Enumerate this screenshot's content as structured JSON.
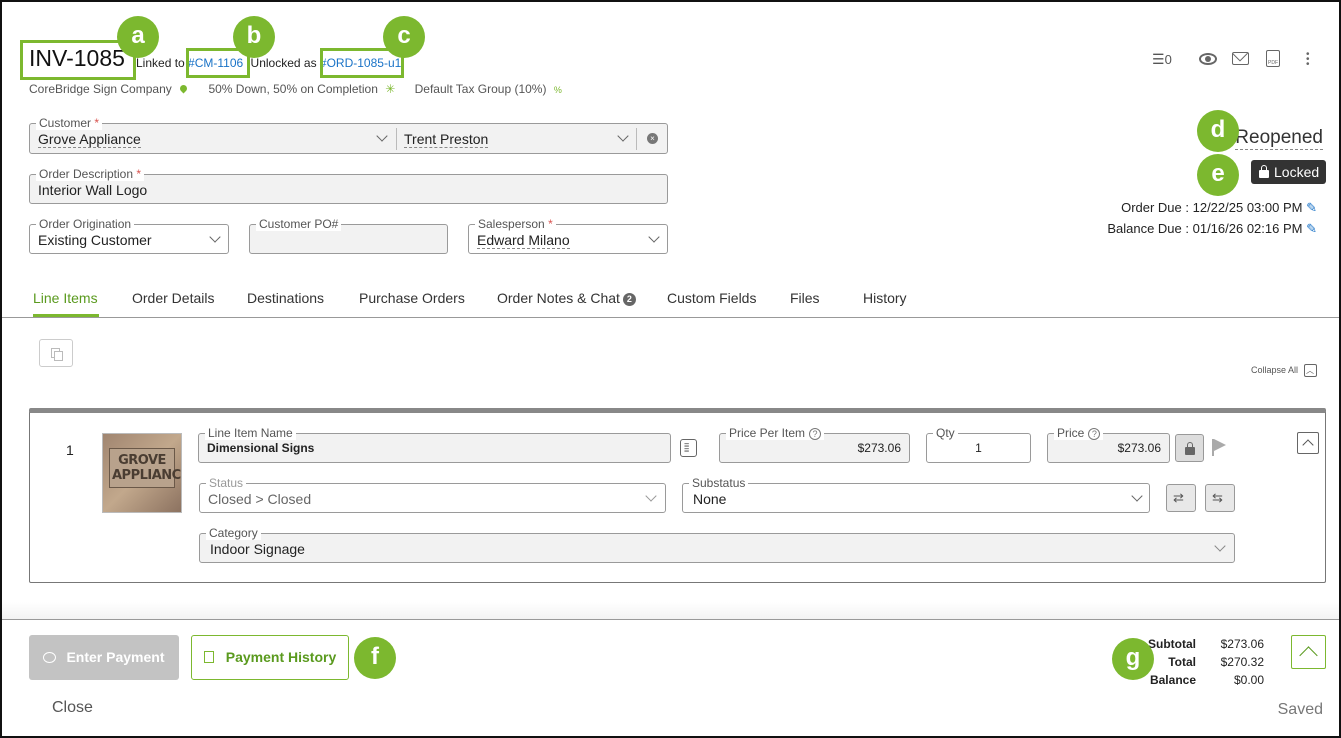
{
  "header": {
    "invoice_number": "INV-1085",
    "linked_to_label": "Linked to",
    "linked_to_value": "#CM-1106",
    "unlocked_label": "Unlocked as",
    "unlocked_value": "#ORD-1085-u1",
    "company": "CoreBridge Sign Company",
    "payment_terms": "50% Down, 50% on Completion",
    "tax_group": "Default Tax Group (10%)",
    "tasks_count": "0"
  },
  "form": {
    "customer": {
      "label": "Customer",
      "value": "Grove Appliance",
      "contact": "Trent Preston"
    },
    "description": {
      "label": "Order Description",
      "value": "Interior Wall Logo"
    },
    "origination": {
      "label": "Order Origination",
      "value": "Existing Customer"
    },
    "po": {
      "label": "Customer PO#",
      "value": ""
    },
    "salesperson": {
      "label": "Salesperson",
      "value": "Edward Milano"
    }
  },
  "status": {
    "state": "Reopened",
    "locked_label": "Locked",
    "order_due": "Order Due : 12/22/25 03:00 PM",
    "balance_due": "Balance Due : 01/16/26 02:16 PM"
  },
  "tabs": [
    {
      "label": "Line Items",
      "active": true
    },
    {
      "label": "Order Details"
    },
    {
      "label": "Destinations"
    },
    {
      "label": "Purchase Orders"
    },
    {
      "label": "Order Notes & Chat",
      "badge": "2"
    },
    {
      "label": "Custom Fields"
    },
    {
      "label": "Files"
    },
    {
      "label": "History"
    }
  ],
  "line_items": {
    "collapse_all": "Collapse All",
    "item": {
      "number": "1",
      "image_text": "GROVE APPLIANCE",
      "name_label": "Line Item Name",
      "name": "Dimensional Signs",
      "ppi_label": "Price Per Item",
      "ppi": "$273.06",
      "qty_label": "Qty",
      "qty": "1",
      "price_label": "Price",
      "price": "$273.06",
      "status_label": "Status",
      "status": "Closed > Closed",
      "substatus_label": "Substatus",
      "substatus": "None",
      "category_label": "Category",
      "category": "Indoor Signage"
    }
  },
  "footer": {
    "enter_payment": "Enter Payment",
    "payment_history": "Payment History",
    "close": "Close",
    "saved": "Saved",
    "subtotal_label": "Subtotal",
    "subtotal": "$273.06",
    "total_label": "Total",
    "total": "$270.32",
    "balance_label": "Balance",
    "balance": "$0.00"
  },
  "callouts": [
    "a",
    "b",
    "c",
    "d",
    "e",
    "f",
    "g"
  ],
  "colors": {
    "accent": "#7cb82f",
    "link": "#1a73c7",
    "locked_bg": "#333333"
  }
}
